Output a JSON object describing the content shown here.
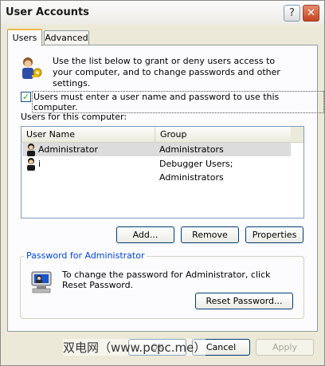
{
  "window": {
    "title": "User Accounts"
  },
  "tabs": [
    {
      "label": "Users"
    },
    {
      "label": "Advanced"
    }
  ],
  "intro_text": "Use the list below to grant or deny users access to your computer, and to change passwords and other settings.",
  "must_login_checkbox": {
    "label": "Users must enter a user name and password to use this computer.",
    "checked": true
  },
  "users_list_label": "Users for this computer:",
  "users_table": {
    "columns": [
      "User Name",
      "Group"
    ],
    "rows": [
      {
        "user": "Administrator",
        "group": "Administrators",
        "selected": true
      },
      {
        "user": "i",
        "group": "Debugger Users; Administrators",
        "selected": false
      }
    ]
  },
  "buttons": {
    "add": "Add...",
    "remove": "Remove",
    "properties": "Properties"
  },
  "password_group": {
    "legend": "Password for Administrator",
    "text": "To change the password for Administrator, click Reset Password.",
    "reset_button": "Reset Password..."
  },
  "footer": {
    "ok": "OK",
    "cancel": "Cancel",
    "apply": "Apply"
  },
  "watermark": "双电网（www.pcpc.me）"
}
